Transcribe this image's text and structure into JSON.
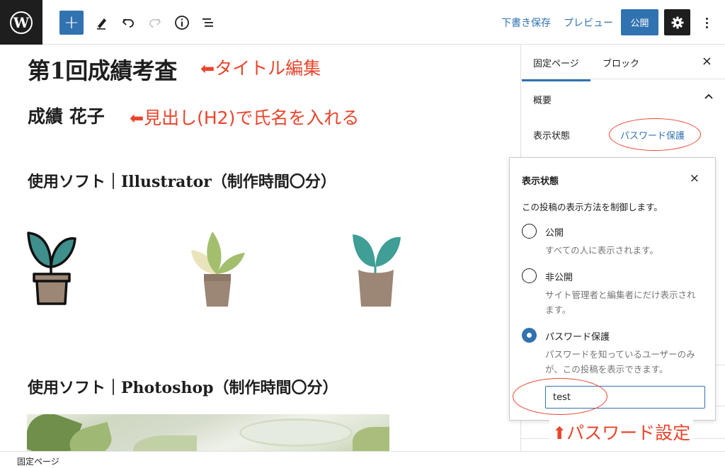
{
  "toolbar": {
    "logo_letter": "W",
    "add_icon": "+",
    "draft_save": "下書き保存",
    "preview": "プレビュー",
    "publish": "公開"
  },
  "content": {
    "title": "第1回成績考査",
    "title_annotation": "タイトル編集",
    "heading": "成績 花子",
    "heading_annotation": "見出し(H2)で氏名を入れる",
    "section1_prefix": "使用ソフト｜",
    "section1_app": "Illustrator",
    "section1_suffix": "（制作時間〇分）",
    "section2_prefix": "使用ソフト｜",
    "section2_app": "Photoshop",
    "section2_suffix": "（制作時間〇分）",
    "arrow_left": "⬅",
    "arrow_up": "⬆"
  },
  "sidebar": {
    "tab_page": "固定ページ",
    "tab_block": "ブロック",
    "close": "×",
    "section_title": "概要",
    "visibility_label": "表示状態",
    "visibility_value": "パスワード保護"
  },
  "popover": {
    "title": "表示状態",
    "close": "×",
    "description": "この投稿の表示方法を制御します。",
    "options": [
      {
        "label": "公開",
        "help": "すべての人に表示されます。"
      },
      {
        "label": "非公開",
        "help": "サイト管理者と編集者にだけ表示されます。"
      },
      {
        "label": "パスワード保護",
        "help": "パスワードを知っているユーザーのみが、この投稿を表示できます。"
      }
    ],
    "password_value": "test",
    "password_annotation": "パスワード設定"
  },
  "statusbar": {
    "label": "固定ページ"
  },
  "colors": {
    "accent": "#3172b1",
    "annotation": "#e8452c",
    "dark": "#1e1e1e"
  }
}
